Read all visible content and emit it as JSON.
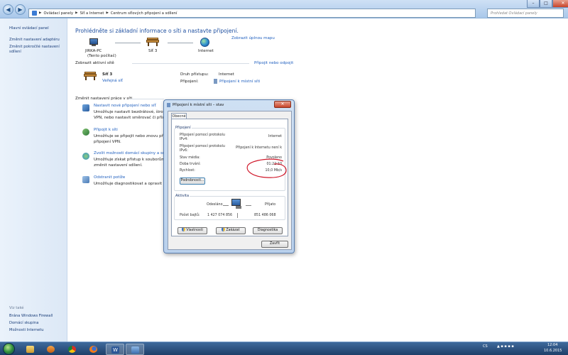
{
  "address_bar": {
    "crumbs": [
      "Ovládací panely",
      "Síť a Internet",
      "Centrum síťových připojení a sdílení"
    ],
    "search_placeholder": "Prohledat Ovládací panely"
  },
  "left_pane": {
    "home": "Hlavní ovládací panel",
    "links": [
      "Změnit nastavení adaptéru",
      "Změnit pokročilé nastavení",
      "sdílení"
    ],
    "see_also_title": "Viz také",
    "see_also": [
      "Brána Windows Firewall",
      "Domácí skupina",
      "Možnosti Internetu"
    ]
  },
  "main": {
    "heading": "Prohlédněte si základní informace o síti a nastavte připojení.",
    "full_map_link": "Zobrazit úplnou mapu",
    "map": {
      "pc_name": "JIRKA-PC",
      "pc_sub": "(Tento počítač)",
      "network": "Síť 3",
      "internet": "Internet"
    },
    "active_title": "Zobrazit aktivní sítě",
    "connect_link": "Připojit nebo odpojit",
    "active_network": {
      "name": "Síť 3",
      "type": "Veřejná síť",
      "access_label": "Druh přístupu:",
      "access_value": "Internet",
      "conn_label": "Připojení:",
      "conn_value": "Připojení k místní síti"
    },
    "settings_title": "Změnit nastavení práce v síti",
    "tasks": [
      {
        "title": "Nastavit nové připojení nebo síť",
        "line1": "Umožňuje nastavit bezdrátové, širokop",
        "line2": "VPN, nebo nastavit směrovač či přístup"
      },
      {
        "title": "Připojit k síti",
        "line1": "Umožňuje se připojit nebo znovu připoj",
        "line2": "připojení VPN."
      },
      {
        "title": "Zvolit možnosti domácí skupiny a sdíle",
        "line1": "Umožňuje získat přístup k souborům a",
        "line2": "změnit nastavení sdílení."
      },
      {
        "title": "Odstranit potíže",
        "line1": "Umožňuje diagnostikovat a opravit pot",
        "line2": ""
      }
    ]
  },
  "dialog": {
    "title": "Připojení k místní síti – stav",
    "tab": "Obecné",
    "connection_group": "Připojení",
    "rows": [
      {
        "label1": "Připojení pomocí protokolu",
        "label2": "IPv4:",
        "value": "Internet"
      },
      {
        "label1": "Připojení pomocí protokolu",
        "label2": "IPv6:",
        "value": "Připojení k Internetu není k"
      },
      {
        "label1": "Stav média:",
        "label2": "",
        "value": "Povoleno"
      },
      {
        "label1": "Doba trvání:",
        "label2": "",
        "value": "01:22:10"
      },
      {
        "label1": "Rychlost:",
        "label2": "",
        "value": "10,0 Mb/s"
      }
    ],
    "details_button": "Podrobnosti...",
    "activity_group": "Aktivita",
    "sent_label": "Odesláno",
    "received_label": "Přijato",
    "bytes_label": "Počet bajtů:",
    "bytes_sent": "1 427 074 856",
    "bytes_received": "851 486 068",
    "properties_button": "Vlastnosti",
    "disable_button": "Zakázat",
    "diagnose_button": "Diagnostika",
    "close_button": "Zavřít"
  },
  "taskbar": {
    "language": "CS",
    "time": "12:04",
    "date": "10.6.2015"
  },
  "colors": {
    "link": "#1f5fbf",
    "heading": "#1e4fa0",
    "annotation": "#d0182a"
  }
}
